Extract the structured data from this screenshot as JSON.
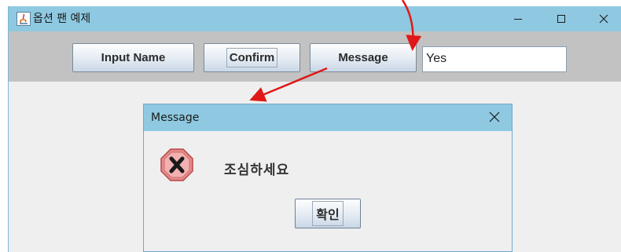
{
  "window": {
    "title": "옵션 팬 예제",
    "controls": [
      "minimize-icon",
      "maximize-icon",
      "close-icon"
    ]
  },
  "toolbar": {
    "input_name_label": "Input Name",
    "confirm_label": "Confirm",
    "message_label": "Message",
    "text_field_value": "Yes"
  },
  "dialog": {
    "title": "Message",
    "icon": "error-icon",
    "message": "조심하세요",
    "ok_label": "확인"
  },
  "colors": {
    "titlebar": "#8ec9e1",
    "toolbar": "#c2c2c2",
    "content": "#efefef",
    "annotation_arrow": "#e01818",
    "error_octagon": "#e58b8b"
  }
}
